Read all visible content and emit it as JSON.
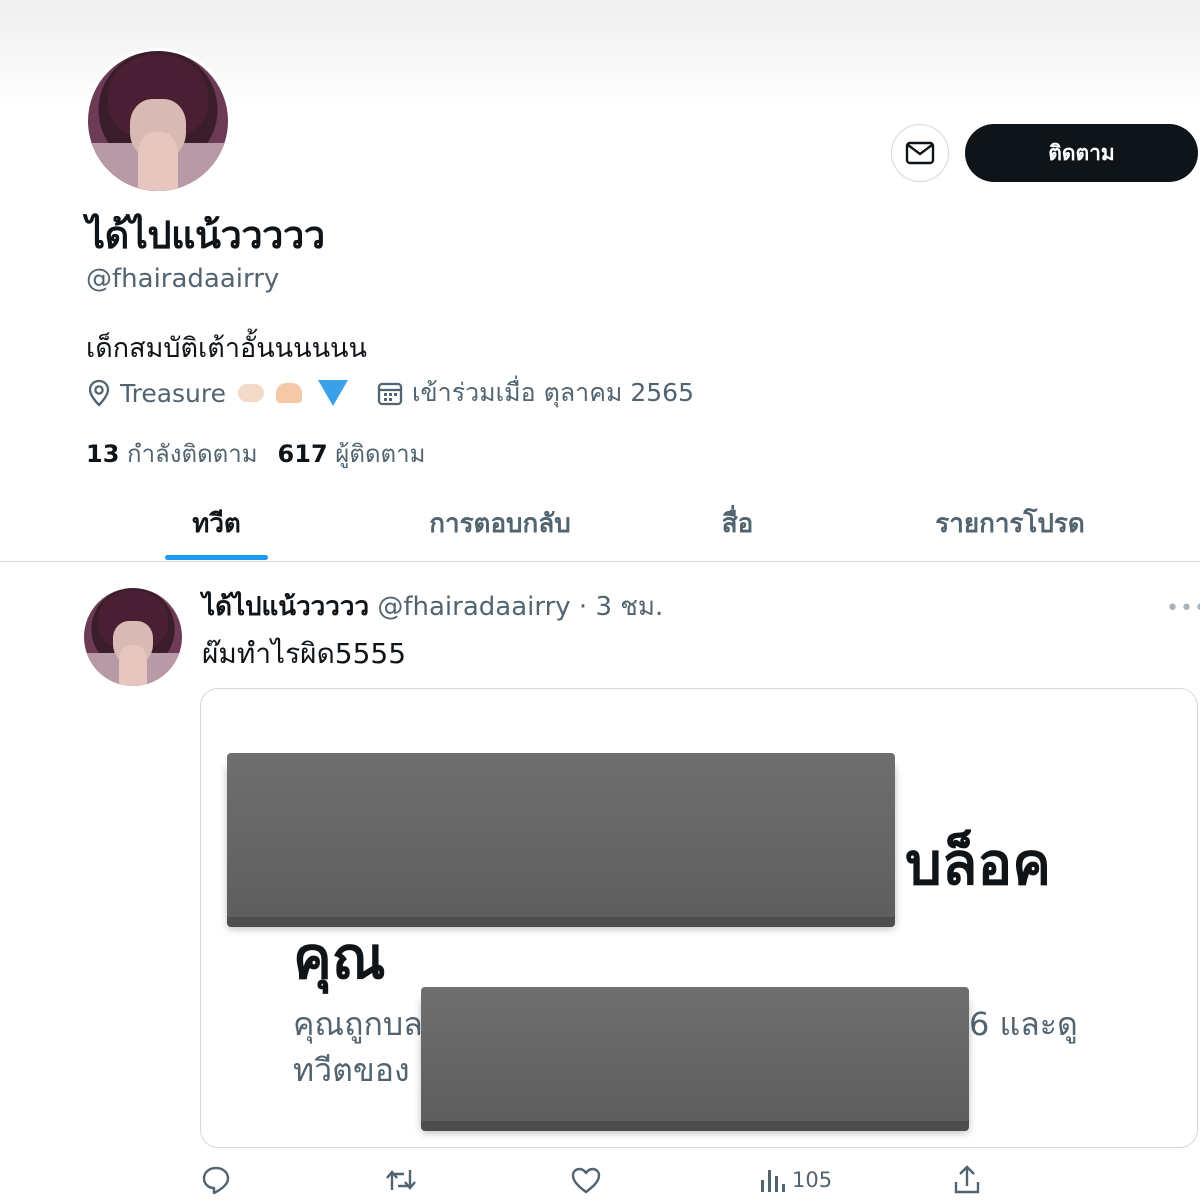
{
  "profile": {
    "display_name": "ได้ไปแน้ววววว",
    "handle": "@fhairadaairry",
    "bio": "เด็กสมบัติเต้าอั้นนนนนน",
    "location": "Treasure",
    "joined": "เข้าร่วมเมื่อ ตุลาคม 2565",
    "following_count": "13",
    "following_label": "กำลังติดตาม",
    "followers_count": "617",
    "followers_label": "ผู้ติดตาม"
  },
  "actions": {
    "follow_label": "ติดตาม"
  },
  "tabs": [
    {
      "label": "ทวีต",
      "active": true
    },
    {
      "label": "การตอบกลับ",
      "active": false
    },
    {
      "label": "สื่อ",
      "active": false
    },
    {
      "label": "รายการโปรด",
      "active": false
    }
  ],
  "tweet": {
    "name": "ได้ไปแน้ววววว",
    "handle": "@fhairadaairry",
    "time": "· 3 ชม.",
    "text": "ผ๊มทำไรผิด5555",
    "card": {
      "line1_visible": "บล็อค",
      "line2_visible": "คุณ",
      "line3_left": "คุณถูกบล",
      "line3_right": "6 และดู",
      "line4_left": "ทวีตของ"
    },
    "views": "105"
  },
  "colors": {
    "accent": "#1d9bf0",
    "text_primary": "#0f1419",
    "text_secondary": "#536471",
    "button_dark": "#0f1419"
  }
}
